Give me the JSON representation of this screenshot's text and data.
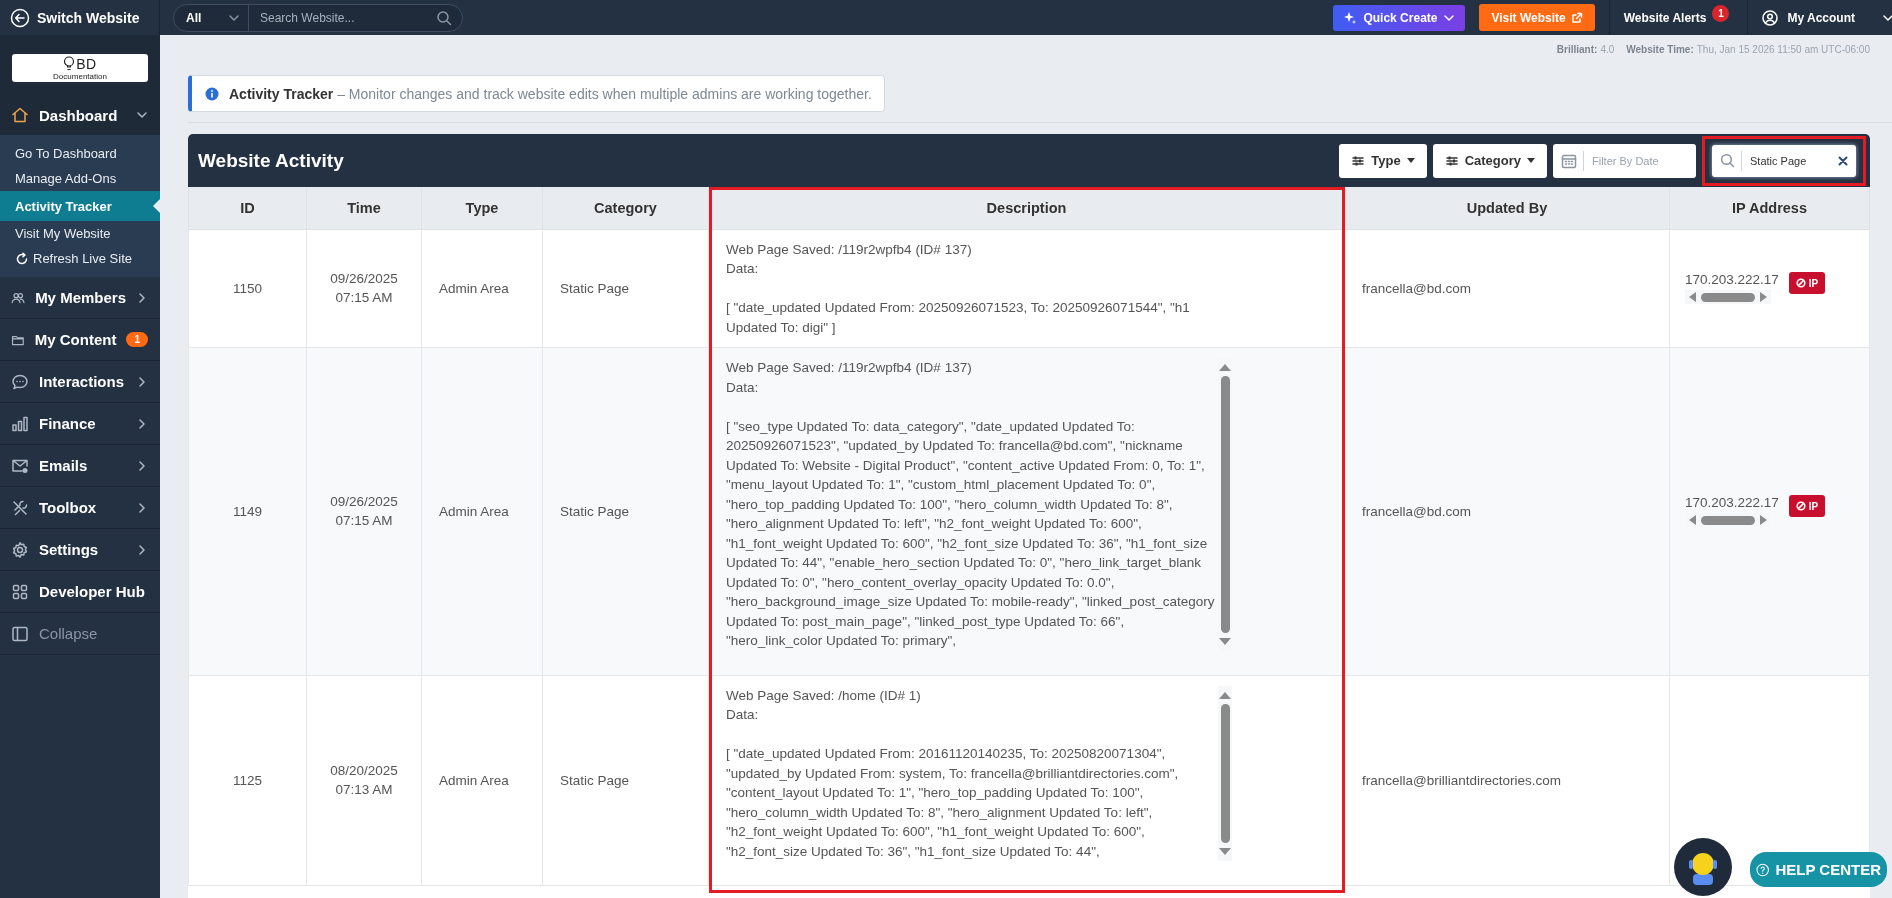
{
  "topbar": {
    "switch_label": "Switch Website",
    "search_scope": "All",
    "search_placeholder": "Search Website...",
    "quick_create": "Quick Create",
    "visit_website": "Visit Website",
    "alerts": {
      "label": "Website Alerts",
      "count": "1"
    },
    "account": "My Account"
  },
  "sidebar": {
    "logo": {
      "text": "BD",
      "subtitle": "Documentation"
    },
    "items": [
      {
        "label": "Dashboard",
        "kind": "menu",
        "expanded": true,
        "children": [
          {
            "label": "Go To Dashboard",
            "kind": "link",
            "selected": false
          },
          {
            "label": "Manage Add-Ons",
            "kind": "link",
            "selected": false
          },
          {
            "label": "Activity Tracker",
            "kind": "link",
            "selected": true
          },
          {
            "label": "Visit My Website",
            "kind": "link",
            "selected": false
          },
          {
            "label": "Refresh Live Site",
            "kind": "action",
            "selected": false
          }
        ]
      },
      {
        "label": "My Members",
        "kind": "menu",
        "expanded": false
      },
      {
        "label": "My Content",
        "kind": "menu",
        "badge": "1"
      },
      {
        "label": "Interactions",
        "kind": "menu",
        "expanded": false
      },
      {
        "label": "Finance",
        "kind": "menu",
        "expanded": false
      },
      {
        "label": "Emails",
        "kind": "menu",
        "expanded": false
      },
      {
        "label": "Toolbox",
        "kind": "menu",
        "expanded": false
      },
      {
        "label": "Settings",
        "kind": "menu",
        "expanded": false
      },
      {
        "label": "Developer Hub",
        "kind": "menu"
      },
      {
        "label": "Collapse",
        "kind": "collapse"
      }
    ]
  },
  "meta": [
    {
      "label": "Brilliant:",
      "value": "4.0"
    },
    {
      "label": "Website Time:",
      "value": "Thu, Jan 15 2026 11:50 am UTC-06:00"
    }
  ],
  "notice": {
    "text": "**Activity Tracker** – Monitor changes and track website edits when multiple admins are working together."
  },
  "activity": {
    "title": "Website Activity",
    "filters": [
      {
        "kind": "dropdown",
        "label": "Type"
      },
      {
        "kind": "dropdown",
        "label": "Category"
      },
      {
        "kind": "date",
        "placeholder": "Filter By Date"
      },
      {
        "kind": "search",
        "value": "Static Page",
        "highlighted": true
      }
    ],
    "columns": [
      {
        "label": "ID",
        "highlighted": false
      },
      {
        "label": "Time",
        "highlighted": false
      },
      {
        "label": "Type",
        "highlighted": false
      },
      {
        "label": "Category",
        "highlighted": false
      },
      {
        "label": "Description",
        "highlighted": true
      },
      {
        "label": "Updated By",
        "highlighted": false
      },
      {
        "label": "IP Address",
        "highlighted": false
      }
    ],
    "rows": [
      {
        "id": "1150",
        "time": "09/26/2025 07:15 AM",
        "type": "Admin Area",
        "category": "Static Page",
        "description": {
          "title": "Web Page Saved: /119r2wpfb4 (ID# 137)",
          "label": "Data:",
          "data": "[ \"date_updated Updated From: 20250926071523, To: 20250926071544\", \"h1 Updated To: digi\" ]",
          "scrollable": false
        },
        "updated_by": "francella@bd.com",
        "ip": "170.203.222.17",
        "block_label": "IP"
      },
      {
        "id": "1149",
        "time": "09/26/2025 07:15 AM",
        "type": "Admin Area",
        "category": "Static Page",
        "description": {
          "title": "Web Page Saved: /119r2wpfb4 (ID# 137)",
          "label": "Data:",
          "data": "[ \"seo_type Updated To: data_category\", \"date_updated Updated To: 20250926071523\", \"updated_by Updated To: francella@bd.com\", \"nickname Updated To: Website - Digital Product\", \"content_active Updated From: 0, To: 1\", \"menu_layout Updated To: 1\", \"custom_html_placement Updated To: 0\", \"hero_top_padding Updated To: 100\", \"hero_column_width Updated To: 8\", \"hero_alignment Updated To: left\", \"h2_font_weight Updated To: 600\", \"h1_font_weight Updated To: 600\", \"h2_font_size Updated To: 36\", \"h1_font_size Updated To: 44\", \"enable_hero_section Updated To: 0\", \"hero_link_target_blank Updated To: 0\", \"hero_content_overlay_opacity Updated To: 0.0\", \"hero_background_image_size Updated To: mobile-ready\", \"linked_post_category Updated To: post_main_page\", \"linked_post_type Updated To: 66\", \"hero_link_color Updated To: primary\",",
          "scrollable": true
        },
        "updated_by": "francella@bd.com",
        "ip": "170.203.222.17",
        "block_label": "IP"
      },
      {
        "id": "1125",
        "time": "08/20/2025 07:13 AM",
        "type": "Admin Area",
        "category": "Static Page",
        "description": {
          "title": "Web Page Saved: /home (ID# 1)",
          "label": "Data:",
          "data": "[ \"date_updated Updated From: 20161120140235, To: 20250820071304\", \"updated_by Updated From: system, To: francella@brilliantdirectories.com\", \"content_layout Updated To: 1\", \"hero_top_padding Updated To: 100\", \"hero_column_width Updated To: 8\", \"hero_alignment Updated To: left\", \"h2_font_weight Updated To: 600\", \"h1_font_weight Updated To: 600\", \"h2_font_size Updated To: 36\", \"h1_font_size Updated To: 44\",",
          "scrollable": true
        },
        "updated_by": "francella@brilliantdirectories.com"
      }
    ]
  },
  "help": {
    "label": "HELP CENTER"
  }
}
